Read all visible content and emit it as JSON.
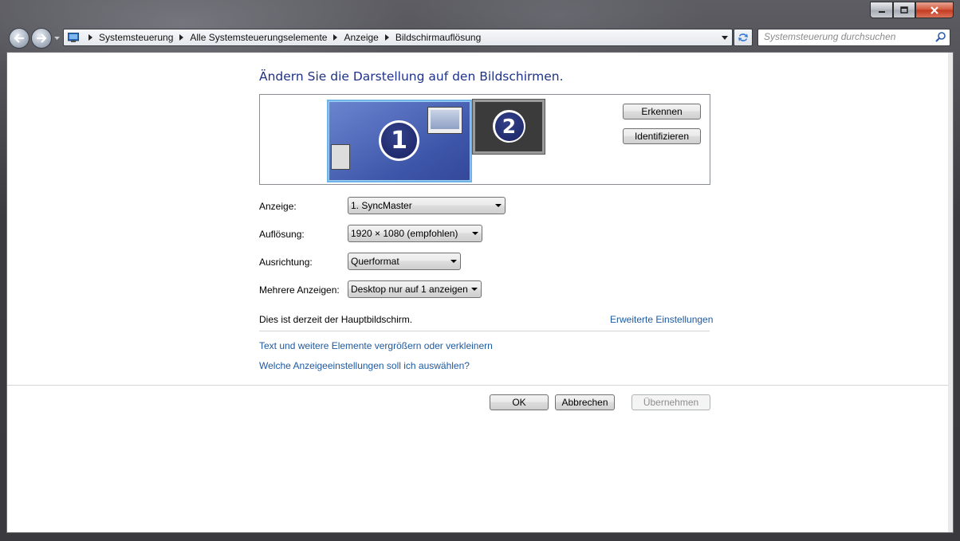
{
  "window": {
    "caption_buttons": [
      "minimize-icon",
      "maximize-icon",
      "close-icon"
    ]
  },
  "navigation": {
    "breadcrumbs": [
      "Systemsteuerung",
      "Alle Systemsteuerungselemente",
      "Anzeige",
      "Bildschirmauflösung"
    ],
    "search_placeholder": "Systemsteuerung durchsuchen"
  },
  "content": {
    "heading": "Ändern Sie die Darstellung auf den Bildschirmen.",
    "monitors": [
      {
        "number": "1",
        "selected": true
      },
      {
        "number": "2",
        "selected": false
      }
    ],
    "buttons": {
      "detect": "Erkennen",
      "identify": "Identifizieren"
    },
    "fields": {
      "display": {
        "label": "Anzeige:",
        "value": "1. SyncMaster"
      },
      "resolution": {
        "label": "Auflösung:",
        "value": "1920 × 1080 (empfohlen)"
      },
      "orientation": {
        "label": "Ausrichtung:",
        "value": "Querformat"
      },
      "multiple": {
        "label": "Mehrere Anzeigen:",
        "value": "Desktop nur auf 1 anzeigen"
      }
    },
    "main_display_text": "Dies ist derzeit der Hauptbildschirm.",
    "links": {
      "advanced": "Erweiterte Einstellungen",
      "text_size": "Text und weitere Elemente vergrößern oder verkleinern",
      "which_settings": "Welche Anzeigeeinstellungen soll ich auswählen?"
    },
    "dialog_buttons": {
      "ok": "OK",
      "cancel": "Abbrechen",
      "apply": "Übernehmen"
    }
  },
  "colors": {
    "heading": "#1e3287",
    "link": "#1e5aa0",
    "selected_monitor_border": "#6fb4e8"
  }
}
